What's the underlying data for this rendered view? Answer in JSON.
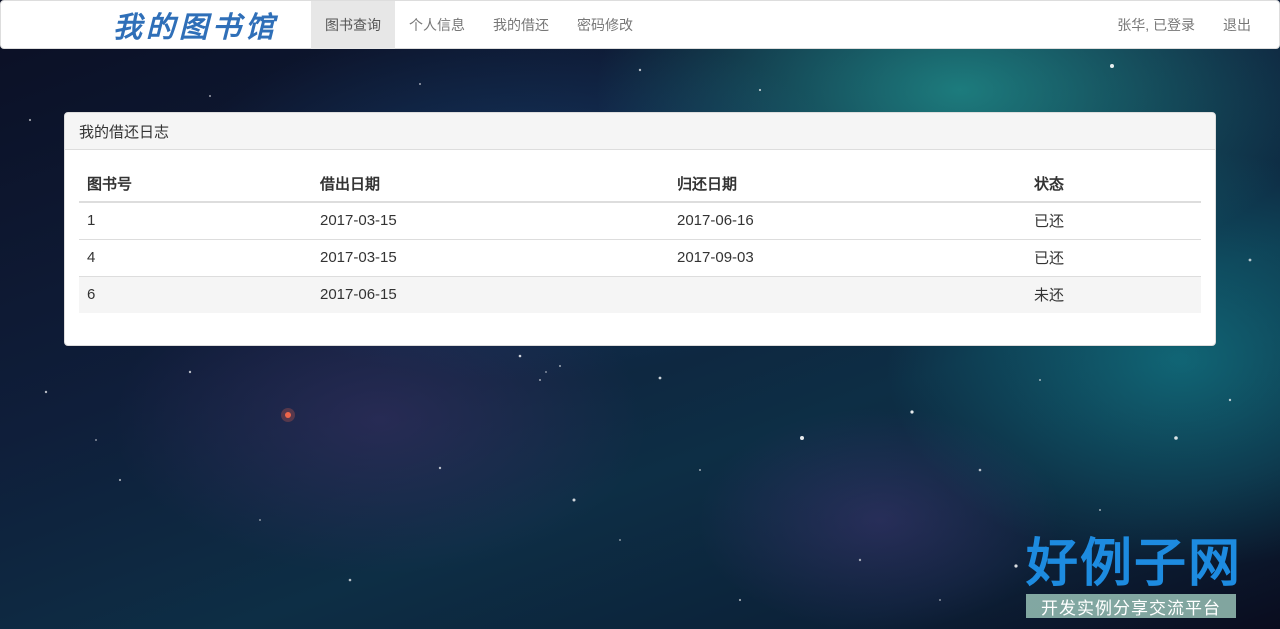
{
  "brand": {
    "title": "我的图书馆"
  },
  "nav": {
    "items": [
      {
        "label": "图书查询",
        "active": true
      },
      {
        "label": "个人信息",
        "active": false
      },
      {
        "label": "我的借还",
        "active": false
      },
      {
        "label": "密码修改",
        "active": false
      }
    ],
    "user_status": "张华, 已登录",
    "logout": "退出"
  },
  "panel": {
    "title": "我的借还日志",
    "table": {
      "headers": [
        "图书号",
        "借出日期",
        "归还日期",
        "状态"
      ],
      "rows": [
        [
          "1",
          "2017-03-15",
          "2017-06-16",
          "已还"
        ],
        [
          "4",
          "2017-03-15",
          "2017-09-03",
          "已还"
        ],
        [
          "6",
          "2017-06-15",
          "",
          "未还"
        ]
      ]
    }
  },
  "watermark": {
    "title": "好例子网",
    "subtitle": "开发实例分享交流平台"
  }
}
